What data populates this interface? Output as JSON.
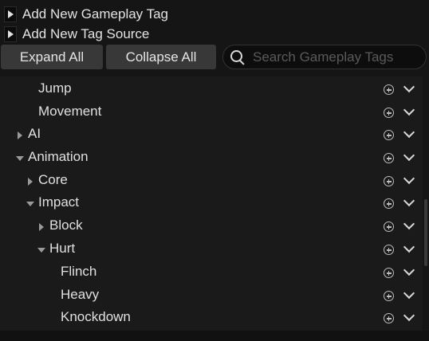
{
  "actions": {
    "add_tag_label": "Add New Gameplay Tag",
    "add_source_label": "Add New Tag Source"
  },
  "toolbar": {
    "expand_label": "Expand All",
    "collapse_label": "Collapse All",
    "search_placeholder": "Search Gameplay Tags",
    "search_value": ""
  },
  "tree": {
    "items": [
      {
        "label": "Jump",
        "expander": "none"
      },
      {
        "label": "Movement",
        "expander": "none"
      },
      {
        "label": "AI",
        "expander": "collapsed"
      },
      {
        "label": "Animation",
        "expander": "expanded"
      },
      {
        "label": "Core",
        "expander": "collapsed"
      },
      {
        "label": "Impact",
        "expander": "expanded"
      },
      {
        "label": "Block",
        "expander": "collapsed"
      },
      {
        "label": "Hurt",
        "expander": "expanded"
      },
      {
        "label": "Flinch",
        "expander": "none"
      },
      {
        "label": "Heavy",
        "expander": "none"
      },
      {
        "label": "Knockdown",
        "expander": "none"
      }
    ]
  },
  "icons": {
    "row_add": "add-circle-icon",
    "row_menu": "chevron-down-icon",
    "search": "search-icon",
    "expand": "triangle-right-icon"
  },
  "colors": {
    "background": "#151515",
    "tree_background": "#1a1a1a",
    "button": "#383838",
    "text": "#e0e0e0"
  }
}
